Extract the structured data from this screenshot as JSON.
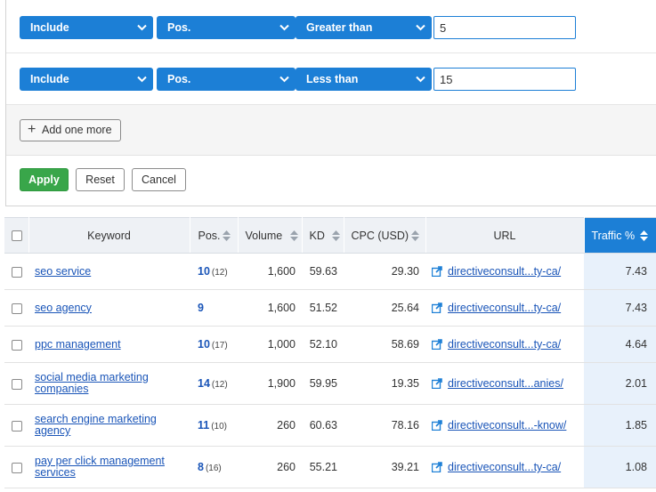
{
  "filters": [
    {
      "include": "Include",
      "field": "Pos.",
      "comparator": "Greater than",
      "value": "5"
    },
    {
      "include": "Include",
      "field": "Pos.",
      "comparator": "Less than",
      "value": "15"
    }
  ],
  "add_label": "Add one more",
  "actions": {
    "apply": "Apply",
    "reset": "Reset",
    "cancel": "Cancel"
  },
  "columns": {
    "keyword": "Keyword",
    "pos": "Pos.",
    "volume": "Volume",
    "kd": "KD",
    "cpc": "CPC (USD)",
    "url": "URL",
    "traffic": "Traffic %"
  },
  "rows": [
    {
      "keyword": "seo service",
      "pos": "10",
      "prev": "(12)",
      "volume": "1,600",
      "kd": "59.63",
      "cpc": "29.30",
      "url": "directiveconsult...ty-ca/",
      "traffic": "7.43"
    },
    {
      "keyword": "seo agency",
      "pos": "9",
      "prev": "",
      "volume": "1,600",
      "kd": "51.52",
      "cpc": "25.64",
      "url": "directiveconsult...ty-ca/",
      "traffic": "7.43"
    },
    {
      "keyword": "ppc management",
      "pos": "10",
      "prev": "(17)",
      "volume": "1,000",
      "kd": "52.10",
      "cpc": "58.69",
      "url": "directiveconsult...ty-ca/",
      "traffic": "4.64"
    },
    {
      "keyword": "social media marketing companies",
      "pos": "14",
      "prev": "(12)",
      "volume": "1,900",
      "kd": "59.95",
      "cpc": "19.35",
      "url": "directiveconsult...anies/",
      "traffic": "2.01"
    },
    {
      "keyword": "search engine marketing agency",
      "pos": "11",
      "prev": "(10)",
      "volume": "260",
      "kd": "60.63",
      "cpc": "78.16",
      "url": "directiveconsult...-know/",
      "traffic": "1.85"
    },
    {
      "keyword": "pay per click management services",
      "pos": "8",
      "prev": "(16)",
      "volume": "260",
      "kd": "55.21",
      "cpc": "39.21",
      "url": "directiveconsult...ty-ca/",
      "traffic": "1.08"
    }
  ],
  "colors": {
    "primary": "#1c7fd6",
    "apply": "#39a64a",
    "link": "#1a55b8",
    "traffic_bg": "#e8f1fb"
  }
}
